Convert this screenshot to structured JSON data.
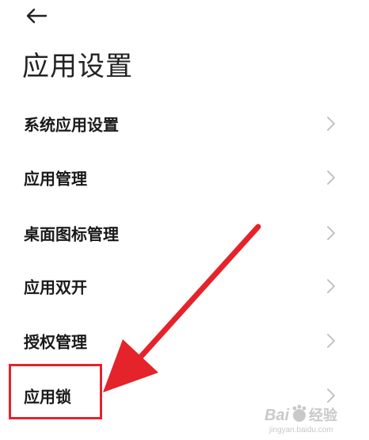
{
  "header": {
    "back_icon": "back-arrow-icon",
    "title": "应用设置"
  },
  "menu": {
    "items": [
      {
        "label": "系统应用设置",
        "icon": "chevron-right-icon"
      },
      {
        "label": "应用管理",
        "icon": "chevron-right-icon"
      },
      {
        "label": "桌面图标管理",
        "icon": "chevron-right-icon"
      },
      {
        "label": "应用双开",
        "icon": "chevron-right-icon"
      },
      {
        "label": "授权管理",
        "icon": "chevron-right-icon"
      },
      {
        "label": "应用锁",
        "icon": "chevron-right-icon"
      }
    ]
  },
  "annotation": {
    "color": "#e5232a",
    "target": "应用锁"
  },
  "watermark": {
    "text_left": "Bai",
    "text_right": "经验",
    "url": "jingyan.baidu.com"
  }
}
